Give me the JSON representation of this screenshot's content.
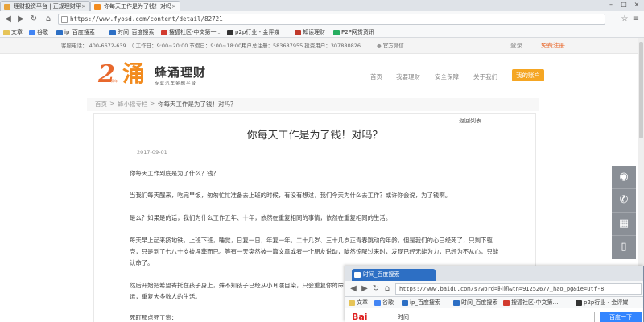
{
  "browser": {
    "tabs": [
      {
        "label": "理财投资平台 | 正规理财平"
      },
      {
        "label": "你每天工作是为了钱！对吗"
      }
    ],
    "url": "https://www.fyosd.com/content/detail/82721",
    "bookmarks": [
      "文章",
      "谷歌",
      "ip_百度搜索",
      "时间_百度搜索",
      "搜狐社区-中文第一…",
      "p2p行业 - 金评媒",
      "知读理财",
      "P2P网贷资讯"
    ]
  },
  "topbar": {
    "phone": "客服电话：  400-6672-639",
    "hours": "（ 工作日：9:00~20:00  节假日：9:00~18:00）",
    "users": "用户总注册：583687955  投资用户：307880826",
    "official": "官方微信",
    "login": "登录",
    "register": "免费注册"
  },
  "brand": {
    "mark": "2",
    "mark_sub": "周年",
    "char": "涌",
    "name": "蜂涌理财",
    "slogan": "专业汽车金融平台"
  },
  "nav": {
    "items": [
      "首页",
      "我要理财",
      "安全保障",
      "关于我们"
    ],
    "account": "我的账户"
  },
  "breadcrumb": {
    "home": "首页",
    "sep1": ">",
    "category": "蜂小摇专栏",
    "sep2": ">",
    "current": "你每天工作是为了钱！对吗？"
  },
  "article": {
    "back": "返回列表",
    "title": "你每天工作是为了钱！对吗？",
    "date": "2017-09-01",
    "paragraphs": [
      "你每天工作到底是为了什么？钱？",
      "当我们每天醒来，吃完早饭，匆匆忙忙准备去上班的时候，有没有想过，我们今天为什么去工作？或许你会说，为了钱啊。",
      "是么？如果是的话，我们为什么工作五年、十年，依然在重复相同的事情，依然在重复相同的生活。",
      "每天早上起来挤地铁，上班下班，睡觉，日复一日，年复一年。二十几岁、三十几岁正青春跳动的年龄，但是我们的心已经死了，只剩下驱壳，只是到了七八十岁被埋葬而已。等有一天突然被一篇文章或者一个朋友说动，陡然惊醒过来时，发现已经无能为力，已经为不从心，只能认命了。",
      "然后开始把希望寄托在孩子身上，殊不知孩子已经从小耳濡目染，只会重复你的命运，重复大多数人的生活。",
      "死盯那点死工资："
    ]
  },
  "popup": {
    "tab": "时间_百度搜索",
    "url": "https://www.baidu.com/s?word=时间&tn=91252677_hao_pg&ie=utf-8",
    "bookmarks": [
      "文章",
      "谷歌",
      "ip_百度搜索",
      "时间_百度搜索",
      "搜狐社区-中文第…",
      "p2p行业 - 金评媒"
    ],
    "search_value": "时间",
    "search_button": "百度一下"
  }
}
